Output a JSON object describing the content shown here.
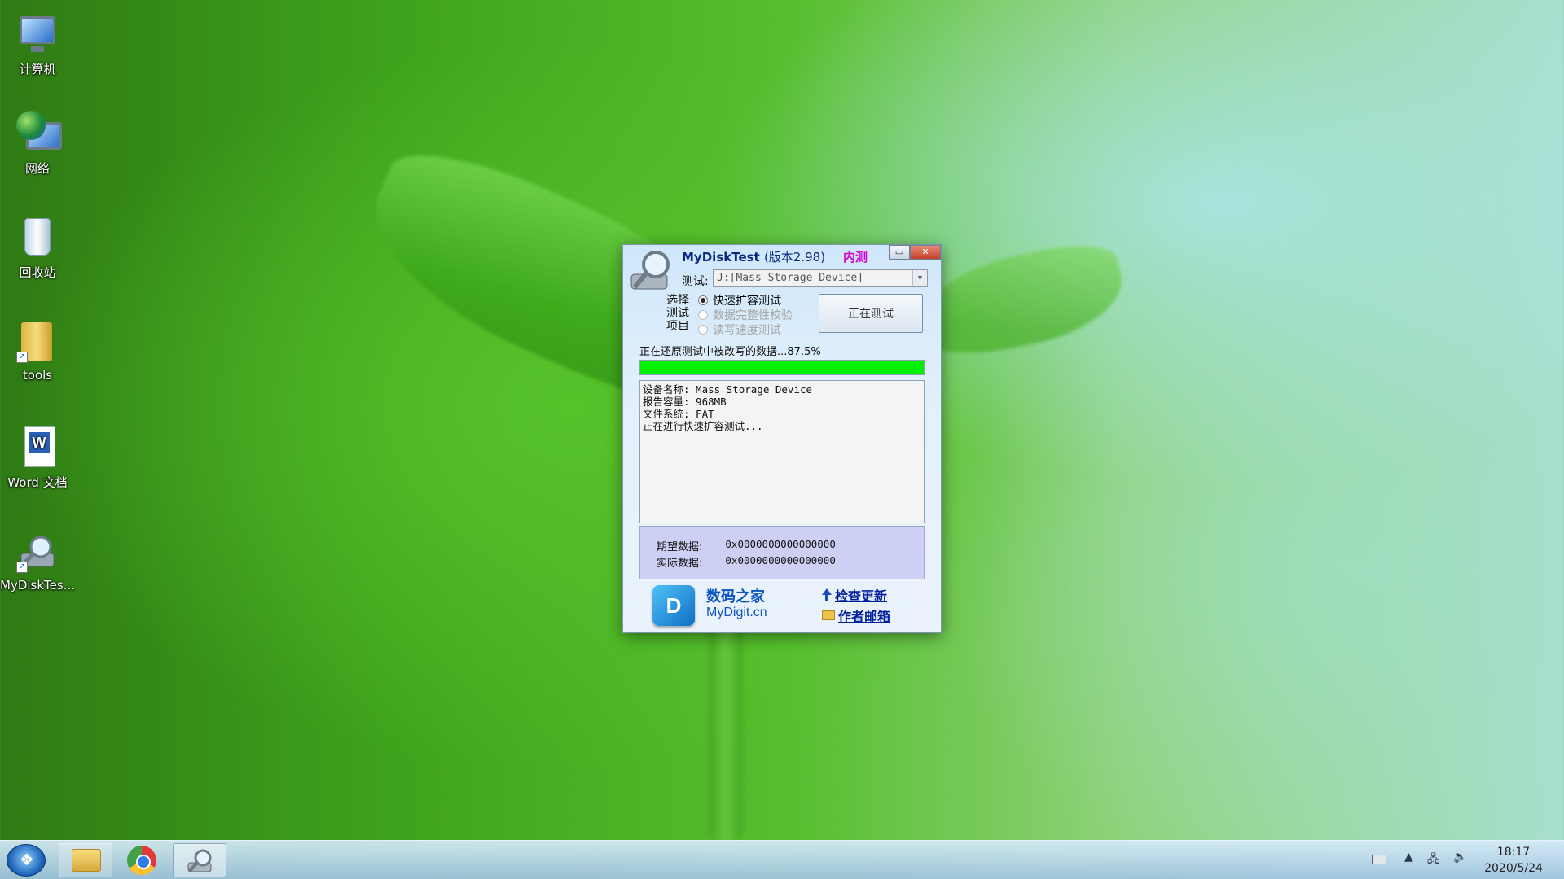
{
  "desktop": {
    "icons": [
      {
        "label": "计算机",
        "icon": "computer-icon"
      },
      {
        "label": "网络",
        "icon": "network-icon"
      },
      {
        "label": "回收站",
        "icon": "recycle-bin-icon"
      },
      {
        "label": "tools",
        "icon": "folder-icon"
      },
      {
        "label": "Word 文档",
        "icon": "word-document-icon"
      },
      {
        "label": "MyDiskTes...",
        "icon": "mydisktest-icon"
      }
    ]
  },
  "window": {
    "title": "MyDiskTest",
    "version": "(版本2.98)",
    "beta_label": "内测",
    "test_label": "测试:",
    "drive": "J:[Mass Storage Device]",
    "choose_label": "选择\n测试\n项目",
    "options": [
      {
        "label": "快速扩容测试",
        "selected": true,
        "enabled": true
      },
      {
        "label": "数据完整性校验",
        "selected": false,
        "enabled": false
      },
      {
        "label": "读写速度测试",
        "selected": false,
        "enabled": false
      }
    ],
    "test_button": "正在测试",
    "status_text": "正在还原测试中被改写的数据...87.5%",
    "progress_percent": 100,
    "log_lines": [
      "设备名称: Mass Storage Device",
      "报告容量: 968MB",
      "文件系统: FAT",
      "",
      "正在进行快速扩容测试..."
    ],
    "expected_label": "期望数据:",
    "expected_value": "0x0000000000000000",
    "actual_label": "实际数据:",
    "actual_value": "0x0000000000000000",
    "brand_name": "数码之家",
    "brand_url": "MyDigit.cn",
    "check_update": "检查更新",
    "author_mail": "作者邮箱",
    "colors": {
      "progress": "#00f000",
      "beta": "#d400d4",
      "data_panel": "#cdd0f4"
    }
  },
  "taskbar": {
    "time": "18:17",
    "date": "2020/5/24"
  }
}
